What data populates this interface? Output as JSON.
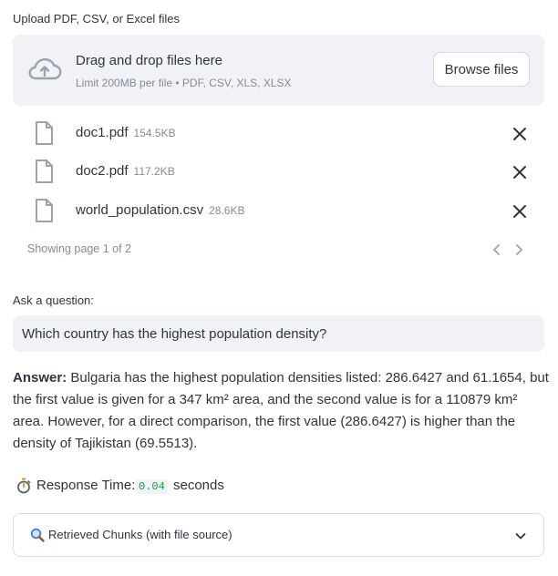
{
  "uploader": {
    "label": "Upload PDF, CSV, or Excel files",
    "dropzone_title": "Drag and drop files here",
    "dropzone_subtitle": "Limit 200MB per file • PDF, CSV, XLS, XLSX",
    "browse_label": "Browse files",
    "icon": "cloud-upload-icon"
  },
  "files": [
    {
      "name": "doc1.pdf",
      "size": "154.5KB"
    },
    {
      "name": "doc2.pdf",
      "size": "117.2KB"
    },
    {
      "name": "world_population.csv",
      "size": "28.6KB"
    }
  ],
  "pagination": {
    "text": "Showing page 1 of 2"
  },
  "question": {
    "label": "Ask a question:",
    "value": "Which country has the highest population density?"
  },
  "answer": {
    "prefix": "Answer:",
    "text": "Bulgaria has the highest population densities listed: 286.6427 and 61.1654, but the first value is given for a 347 km² area, and the second value is for a 110879 km² area. However, for a direct comparison, the first value (286.6427) is higher than the density of Tajikistan (69.5513)."
  },
  "response_time": {
    "label": "Response Time:",
    "value": "0.04",
    "unit": "seconds",
    "value_color": "#09ab3b"
  },
  "expander": {
    "label": "Retrieved Chunks (with file source)"
  },
  "colors": {
    "panel_bg": "#f0f2f6",
    "text": "#31333f",
    "muted": "#888a93"
  }
}
